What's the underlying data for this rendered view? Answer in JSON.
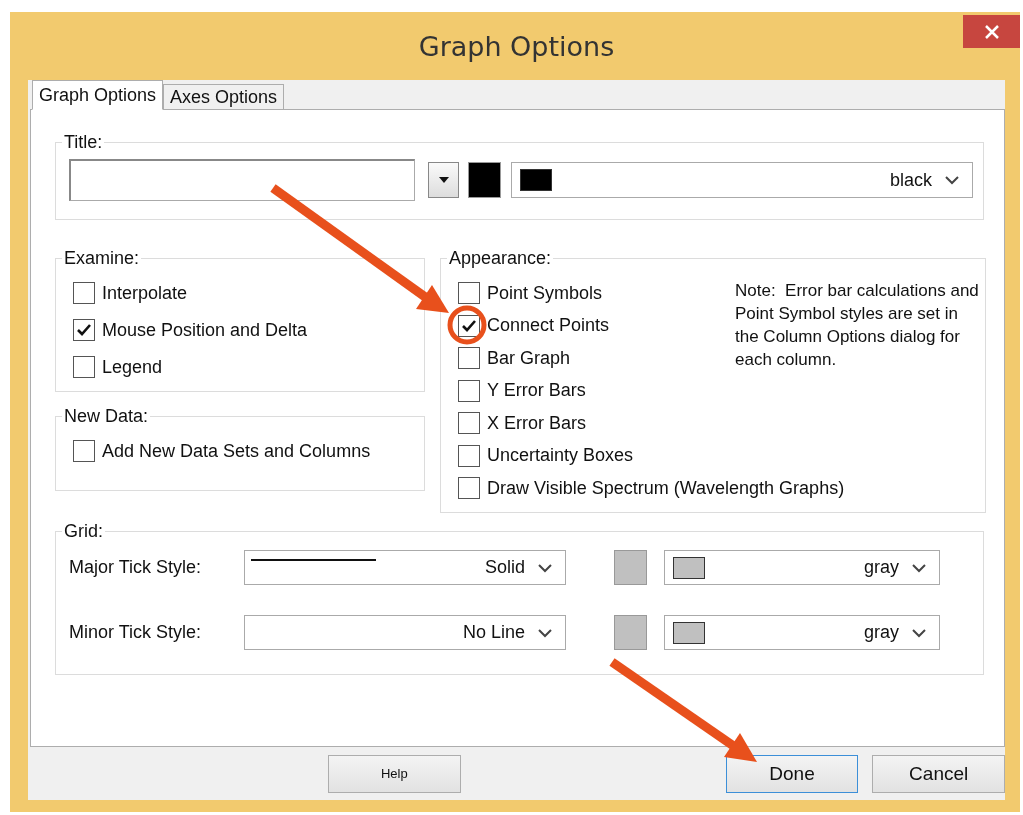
{
  "window": {
    "title": "Graph Options"
  },
  "tabs": [
    {
      "label": "Graph Options",
      "selected": true
    },
    {
      "label": "Axes Options",
      "selected": false
    }
  ],
  "title_group": {
    "legend": "Title:",
    "color": "#000000",
    "color_name": "black"
  },
  "examine": {
    "legend": "Examine:",
    "options": [
      {
        "label": "Interpolate",
        "checked": false
      },
      {
        "label": "Mouse Position and Delta",
        "checked": true
      },
      {
        "label": "Legend",
        "checked": false
      }
    ]
  },
  "new_data": {
    "legend": "New Data:",
    "options": [
      {
        "label": "Add New Data Sets and Columns",
        "checked": false
      }
    ]
  },
  "appearance": {
    "legend": "Appearance:",
    "options": [
      {
        "label": "Point Symbols",
        "checked": false
      },
      {
        "label": "Connect Points",
        "checked": true
      },
      {
        "label": "Bar Graph",
        "checked": false
      },
      {
        "label": "Y Error Bars",
        "checked": false
      },
      {
        "label": "X Error Bars",
        "checked": false
      },
      {
        "label": "Uncertainty Boxes",
        "checked": false
      },
      {
        "label": "Draw Visible Spectrum (Wavelength Graphs)",
        "checked": false
      }
    ],
    "note": "Note:  Error bar calculations and Point Symbol styles are set in the Column Options dialog for each column."
  },
  "grid": {
    "legend": "Grid:",
    "rows": [
      {
        "label": "Major Tick Style:",
        "style": "Solid",
        "kind": "solid",
        "color": "#c0c0c0",
        "color_name": "gray"
      },
      {
        "label": "Minor Tick Style:",
        "style": "No Line",
        "kind": "none",
        "color": "#c0c0c0",
        "color_name": "gray"
      }
    ]
  },
  "buttons": [
    {
      "label": "Help",
      "kind": "small",
      "focused": false
    },
    {
      "label": "Done",
      "kind": "normal",
      "focused": true
    },
    {
      "label": "Cancel",
      "kind": "normal",
      "focused": false
    }
  ]
}
